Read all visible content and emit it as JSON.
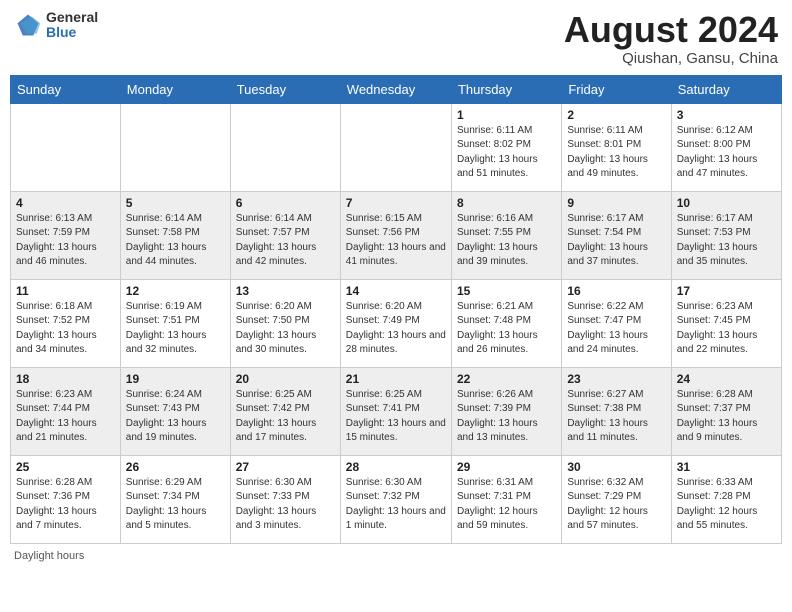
{
  "header": {
    "logo_general": "General",
    "logo_blue": "Blue",
    "month_year": "August 2024",
    "location": "Qiushan, Gansu, China"
  },
  "days_of_week": [
    "Sunday",
    "Monday",
    "Tuesday",
    "Wednesday",
    "Thursday",
    "Friday",
    "Saturday"
  ],
  "weeks": [
    [
      {
        "day": "",
        "info": ""
      },
      {
        "day": "",
        "info": ""
      },
      {
        "day": "",
        "info": ""
      },
      {
        "day": "",
        "info": ""
      },
      {
        "day": "1",
        "info": "Sunrise: 6:11 AM\nSunset: 8:02 PM\nDaylight: 13 hours and 51 minutes."
      },
      {
        "day": "2",
        "info": "Sunrise: 6:11 AM\nSunset: 8:01 PM\nDaylight: 13 hours and 49 minutes."
      },
      {
        "day": "3",
        "info": "Sunrise: 6:12 AM\nSunset: 8:00 PM\nDaylight: 13 hours and 47 minutes."
      }
    ],
    [
      {
        "day": "4",
        "info": "Sunrise: 6:13 AM\nSunset: 7:59 PM\nDaylight: 13 hours and 46 minutes."
      },
      {
        "day": "5",
        "info": "Sunrise: 6:14 AM\nSunset: 7:58 PM\nDaylight: 13 hours and 44 minutes."
      },
      {
        "day": "6",
        "info": "Sunrise: 6:14 AM\nSunset: 7:57 PM\nDaylight: 13 hours and 42 minutes."
      },
      {
        "day": "7",
        "info": "Sunrise: 6:15 AM\nSunset: 7:56 PM\nDaylight: 13 hours and 41 minutes."
      },
      {
        "day": "8",
        "info": "Sunrise: 6:16 AM\nSunset: 7:55 PM\nDaylight: 13 hours and 39 minutes."
      },
      {
        "day": "9",
        "info": "Sunrise: 6:17 AM\nSunset: 7:54 PM\nDaylight: 13 hours and 37 minutes."
      },
      {
        "day": "10",
        "info": "Sunrise: 6:17 AM\nSunset: 7:53 PM\nDaylight: 13 hours and 35 minutes."
      }
    ],
    [
      {
        "day": "11",
        "info": "Sunrise: 6:18 AM\nSunset: 7:52 PM\nDaylight: 13 hours and 34 minutes."
      },
      {
        "day": "12",
        "info": "Sunrise: 6:19 AM\nSunset: 7:51 PM\nDaylight: 13 hours and 32 minutes."
      },
      {
        "day": "13",
        "info": "Sunrise: 6:20 AM\nSunset: 7:50 PM\nDaylight: 13 hours and 30 minutes."
      },
      {
        "day": "14",
        "info": "Sunrise: 6:20 AM\nSunset: 7:49 PM\nDaylight: 13 hours and 28 minutes."
      },
      {
        "day": "15",
        "info": "Sunrise: 6:21 AM\nSunset: 7:48 PM\nDaylight: 13 hours and 26 minutes."
      },
      {
        "day": "16",
        "info": "Sunrise: 6:22 AM\nSunset: 7:47 PM\nDaylight: 13 hours and 24 minutes."
      },
      {
        "day": "17",
        "info": "Sunrise: 6:23 AM\nSunset: 7:45 PM\nDaylight: 13 hours and 22 minutes."
      }
    ],
    [
      {
        "day": "18",
        "info": "Sunrise: 6:23 AM\nSunset: 7:44 PM\nDaylight: 13 hours and 21 minutes."
      },
      {
        "day": "19",
        "info": "Sunrise: 6:24 AM\nSunset: 7:43 PM\nDaylight: 13 hours and 19 minutes."
      },
      {
        "day": "20",
        "info": "Sunrise: 6:25 AM\nSunset: 7:42 PM\nDaylight: 13 hours and 17 minutes."
      },
      {
        "day": "21",
        "info": "Sunrise: 6:25 AM\nSunset: 7:41 PM\nDaylight: 13 hours and 15 minutes."
      },
      {
        "day": "22",
        "info": "Sunrise: 6:26 AM\nSunset: 7:39 PM\nDaylight: 13 hours and 13 minutes."
      },
      {
        "day": "23",
        "info": "Sunrise: 6:27 AM\nSunset: 7:38 PM\nDaylight: 13 hours and 11 minutes."
      },
      {
        "day": "24",
        "info": "Sunrise: 6:28 AM\nSunset: 7:37 PM\nDaylight: 13 hours and 9 minutes."
      }
    ],
    [
      {
        "day": "25",
        "info": "Sunrise: 6:28 AM\nSunset: 7:36 PM\nDaylight: 13 hours and 7 minutes."
      },
      {
        "day": "26",
        "info": "Sunrise: 6:29 AM\nSunset: 7:34 PM\nDaylight: 13 hours and 5 minutes."
      },
      {
        "day": "27",
        "info": "Sunrise: 6:30 AM\nSunset: 7:33 PM\nDaylight: 13 hours and 3 minutes."
      },
      {
        "day": "28",
        "info": "Sunrise: 6:30 AM\nSunset: 7:32 PM\nDaylight: 13 hours and 1 minute."
      },
      {
        "day": "29",
        "info": "Sunrise: 6:31 AM\nSunset: 7:31 PM\nDaylight: 12 hours and 59 minutes."
      },
      {
        "day": "30",
        "info": "Sunrise: 6:32 AM\nSunset: 7:29 PM\nDaylight: 12 hours and 57 minutes."
      },
      {
        "day": "31",
        "info": "Sunrise: 6:33 AM\nSunset: 7:28 PM\nDaylight: 12 hours and 55 minutes."
      }
    ]
  ],
  "footer": {
    "daylight_label": "Daylight hours"
  }
}
